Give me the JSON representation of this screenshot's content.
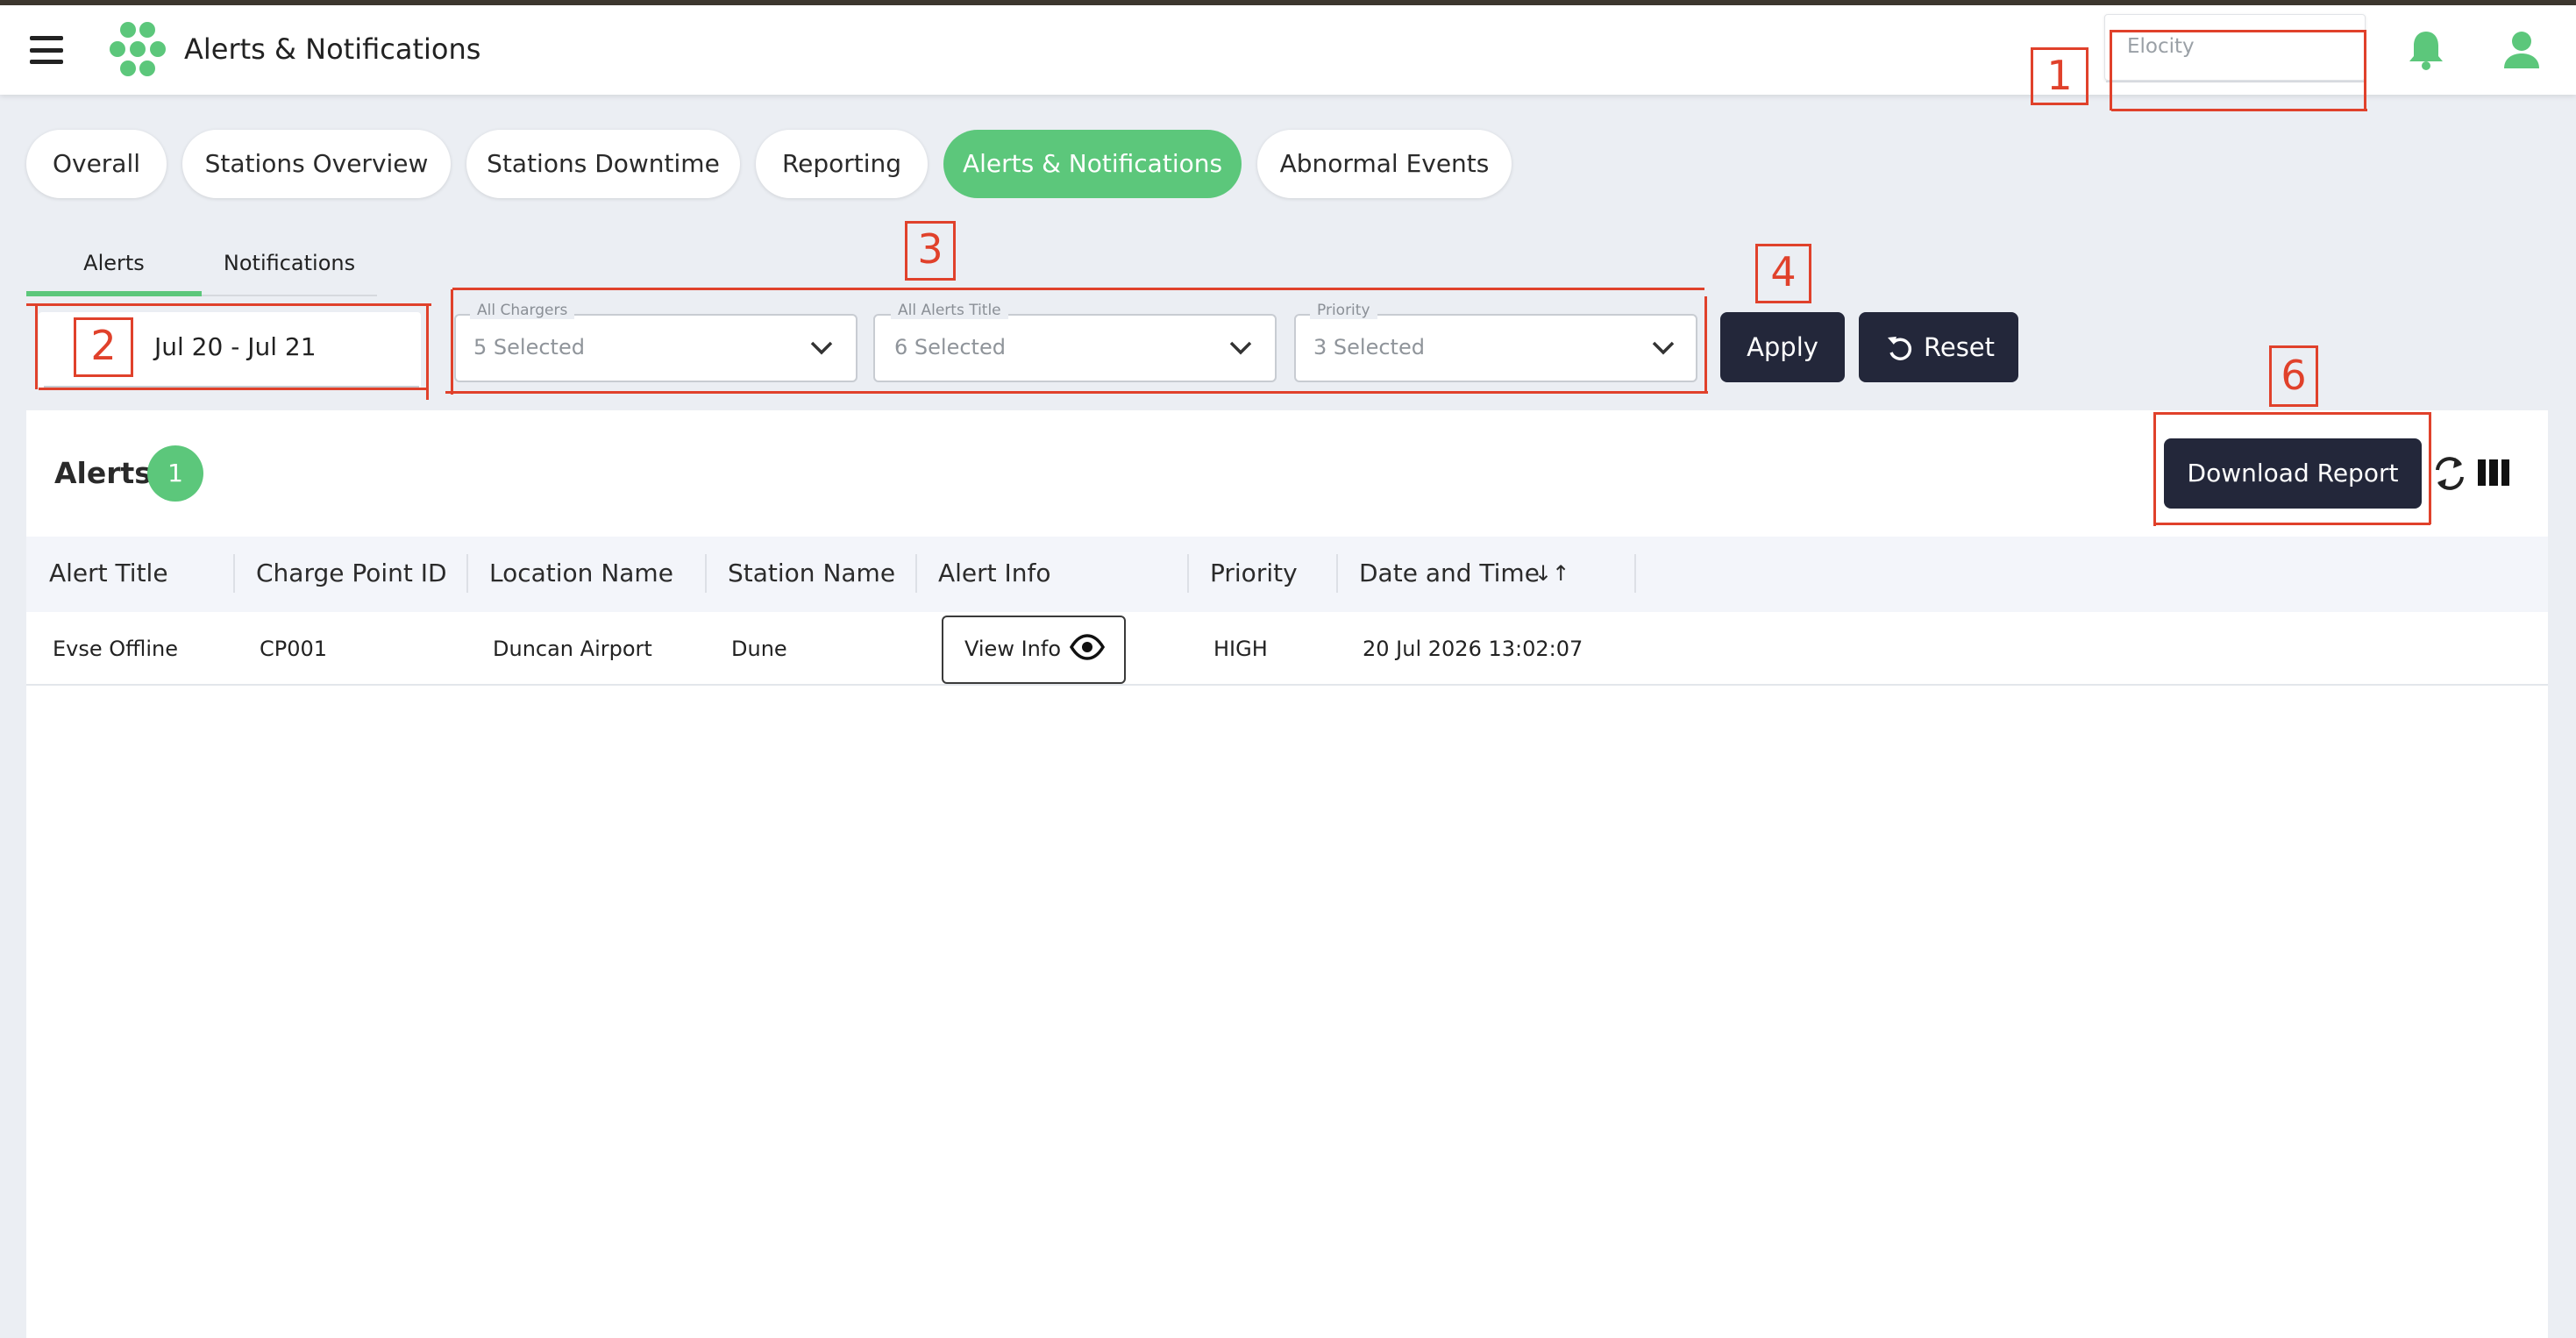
{
  "header": {
    "app_title": "Alerts & Notifications",
    "org_selector": {
      "value": "Elocity"
    },
    "icons": [
      "menu-icon",
      "logo-icon",
      "bell-icon",
      "user-icon"
    ],
    "brand_color": "#5cc77b"
  },
  "nav": {
    "tabs": [
      {
        "label": "Overall"
      },
      {
        "label": "Stations Overview"
      },
      {
        "label": "Stations Downtime"
      },
      {
        "label": "Reporting"
      },
      {
        "label": "Alerts & Notifications",
        "active": true
      },
      {
        "label": "Abnormal Events"
      }
    ]
  },
  "subtabs": {
    "items": [
      {
        "label": "Alerts",
        "active": true
      },
      {
        "label": "Notifications"
      }
    ]
  },
  "filters": {
    "date_range": "Jul 20 - Jul 21",
    "chargers": {
      "label": "All Chargers",
      "value": "5 Selected"
    },
    "alert_titles": {
      "label": "All Alerts Title",
      "value": "6 Selected"
    },
    "priority": {
      "label": "Priority",
      "value": "3 Selected"
    },
    "apply_label": "Apply",
    "reset_label": "Reset"
  },
  "alerts_table": {
    "title": "Alerts",
    "count": "1",
    "download_label": "Download Report",
    "columns": [
      "Alert Title",
      "Charge Point ID",
      "Location Name",
      "Station Name",
      "Alert Info",
      "Priority",
      "Date and Time"
    ],
    "sort_indicator": "↓↑",
    "rows": [
      {
        "alert_title": "Evse Offline",
        "charge_point_id": "CP001",
        "location_name": "Duncan Airport",
        "station_name": "Dune",
        "alert_info": "View Info",
        "priority": "HIGH",
        "date_time": "20 Jul 2026 13:02:07"
      }
    ]
  },
  "annotations": {
    "markers": [
      "1",
      "2",
      "3",
      "4",
      "6"
    ],
    "color": "#e0412b"
  }
}
